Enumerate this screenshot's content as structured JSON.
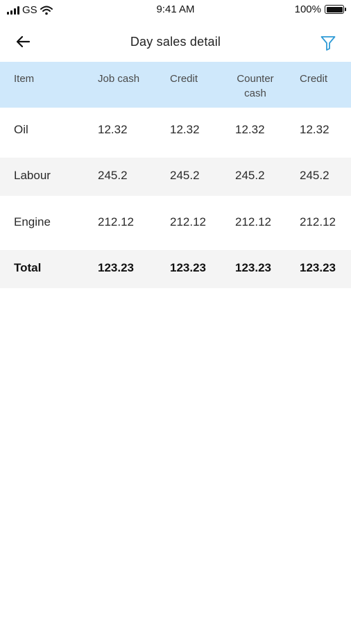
{
  "status_bar": {
    "carrier": "GS",
    "time": "9:41 AM",
    "battery": "100%"
  },
  "header": {
    "title": "Day sales detail"
  },
  "table": {
    "headers": [
      "Item",
      "Job cash",
      "Credit",
      "Counter cash",
      "Credit"
    ],
    "header_lines": {
      "counter_line1": "Counter",
      "counter_line2": "cash"
    },
    "rows": [
      {
        "item": "Oil",
        "job_cash": "12.32",
        "credit": "12.32",
        "counter_cash": "12.32",
        "credit2": "12.32"
      },
      {
        "item": "Labour",
        "job_cash": "245.2",
        "credit": "245.2",
        "counter_cash": "245.2",
        "credit2": "245.2"
      },
      {
        "item": "Engine",
        "job_cash": "212.12",
        "credit": "212.12",
        "counter_cash": "212.12",
        "credit2": "212.12"
      }
    ],
    "total": {
      "item": "Total",
      "job_cash": "123.23",
      "credit": "123.23",
      "counter_cash": "123.23",
      "credit2": "123.23"
    }
  },
  "colors": {
    "header_bg": "#cfe8fb",
    "stripe_bg": "#f4f4f4",
    "filter_icon": "#2f9bd6"
  },
  "icons": {
    "back": "arrow-left-icon",
    "filter": "filter-icon",
    "signal": "signal-icon",
    "wifi": "wifi-icon",
    "battery": "battery-icon"
  }
}
